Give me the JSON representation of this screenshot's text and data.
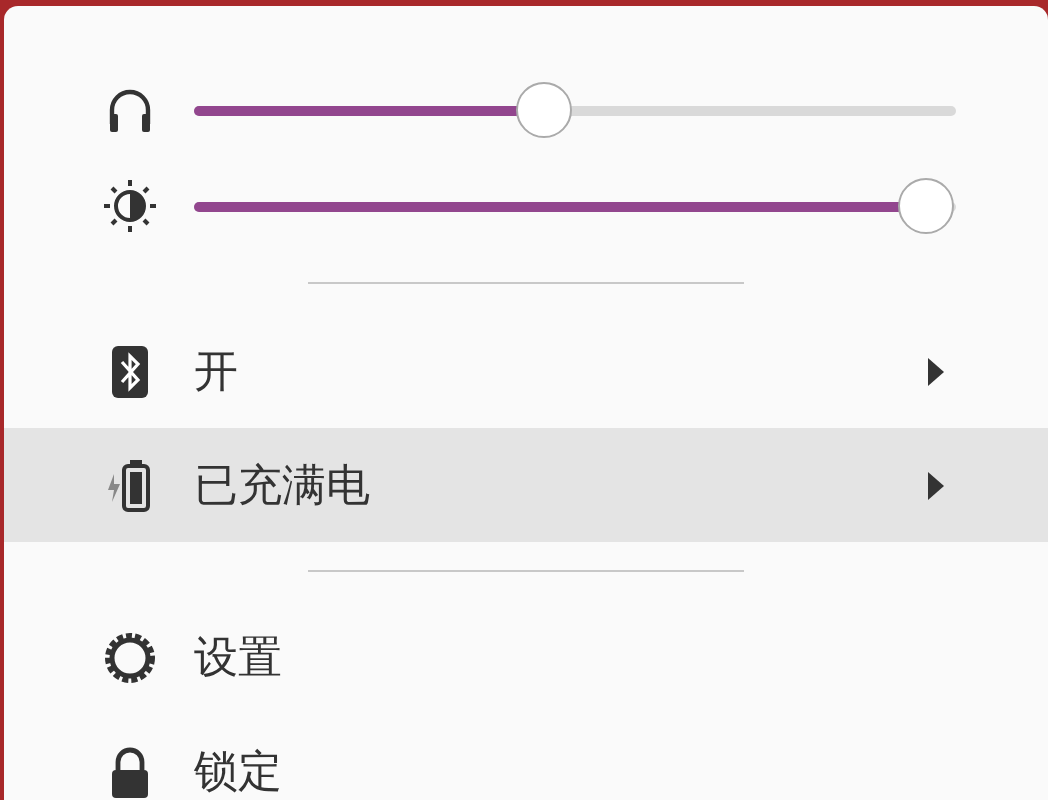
{
  "sliders": [
    {
      "kind": "volume",
      "level": 0.46
    },
    {
      "kind": "brightness",
      "level": 0.96
    }
  ],
  "menu_groups": [
    [
      {
        "kind": "bluetooth",
        "label": "开",
        "submenu": true,
        "selected": false
      },
      {
        "kind": "battery",
        "label": "已充满电",
        "submenu": true,
        "selected": true
      }
    ],
    [
      {
        "kind": "settings",
        "label": "设置",
        "submenu": false,
        "selected": false
      },
      {
        "kind": "lock",
        "label": "锁定",
        "submenu": false,
        "selected": false
      }
    ]
  ]
}
